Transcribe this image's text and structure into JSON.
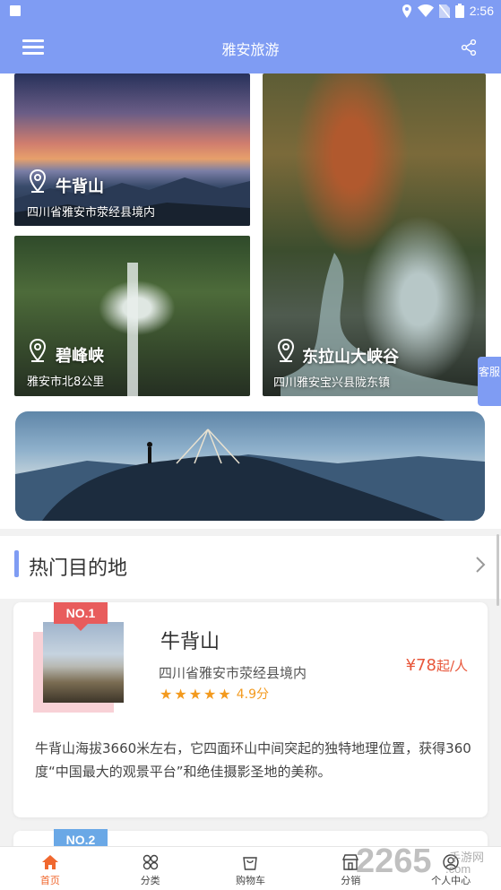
{
  "status_bar": {
    "time": "2:56",
    "icons": [
      "location-icon",
      "wifi-icon",
      "no-sim-icon",
      "battery-icon"
    ]
  },
  "app_bar": {
    "title": "雅安旅游",
    "left_icon": "menu-icon",
    "right_icon": "share-icon"
  },
  "tiles": [
    {
      "name": "牛背山",
      "location": "四川省雅安市荥经县境内"
    },
    {
      "name": "碧峰峡",
      "location": "雅安市北8公里"
    },
    {
      "name": "东拉山大峡谷",
      "location": "四川雅安宝兴县陇东镇"
    }
  ],
  "side_tab": {
    "label": "客服"
  },
  "hot_section": {
    "title": "热门目的地",
    "more_icon": "chevron-right-icon"
  },
  "destinations": [
    {
      "rank": "NO.1",
      "name": "牛背山",
      "location": "四川省雅安市荥经县境内",
      "price": "¥78",
      "price_unit": "起/人",
      "rating": 5,
      "score": "4.9分",
      "description": "牛背山海拔3660米左右，它四面环山中间突起的独特地理位置，获得360度“中国最大的观景平台”和绝佳摄影圣地的美称。"
    },
    {
      "rank": "NO.2"
    }
  ],
  "bottom_nav": [
    {
      "label": "首页",
      "icon": "home-icon",
      "active": true
    },
    {
      "label": "分类",
      "icon": "category-icon",
      "active": false
    },
    {
      "label": "购物车",
      "icon": "cart-icon",
      "active": false
    },
    {
      "label": "分销",
      "icon": "store-icon",
      "active": false
    },
    {
      "label": "个人中心",
      "icon": "profile-icon",
      "active": false
    }
  ],
  "watermark": {
    "big": "2265",
    "small1": "手游网",
    "small2": ".com"
  },
  "colors": {
    "primary": "#7f9cf3",
    "accent": "#f0682f",
    "price": "#e8563a",
    "star": "#f39a1e",
    "rank1": "#e85c5c",
    "rank2": "#6aa8e6"
  }
}
